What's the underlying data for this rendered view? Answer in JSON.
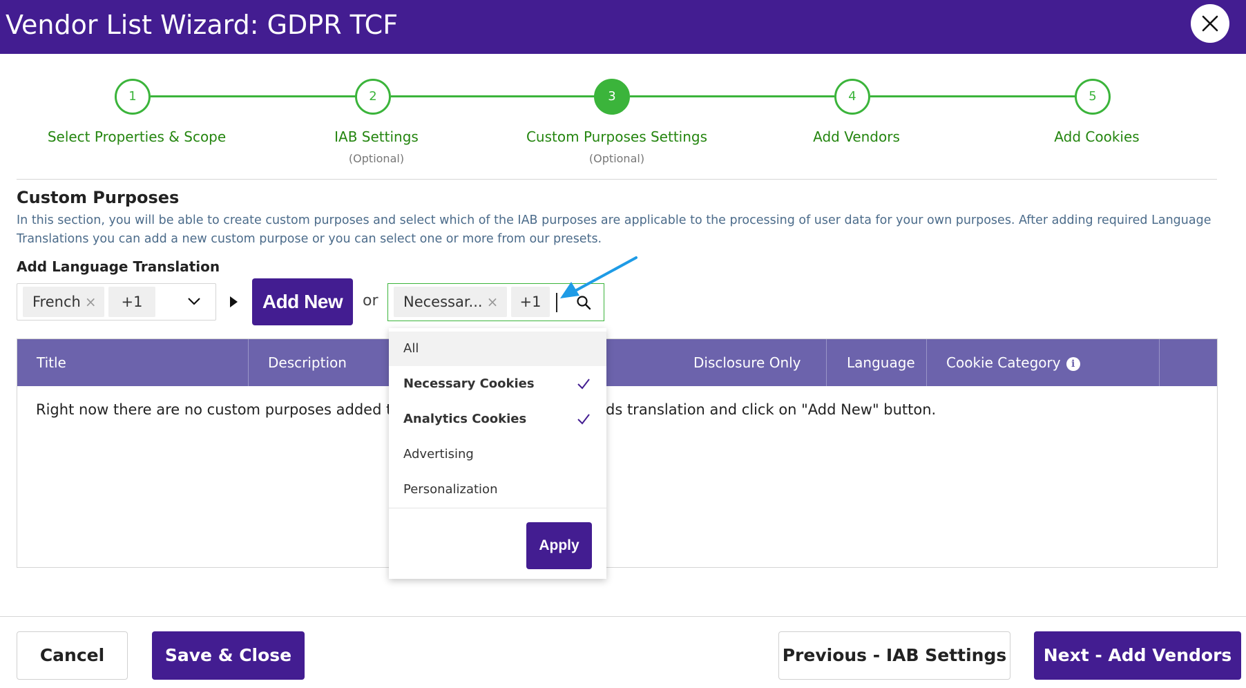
{
  "header": {
    "title": "Vendor List Wizard: GDPR TCF",
    "close_icon": "close-icon"
  },
  "stepper": {
    "steps": [
      {
        "number": "1",
        "label": "Select Properties & Scope",
        "sub": "",
        "state": "complete"
      },
      {
        "number": "2",
        "label": "IAB Settings",
        "sub": "(Optional)",
        "state": "complete"
      },
      {
        "number": "3",
        "label": "Custom Purposes Settings",
        "sub": "(Optional)",
        "state": "active"
      },
      {
        "number": "4",
        "label": "Add Vendors",
        "sub": "",
        "state": "upcoming"
      },
      {
        "number": "5",
        "label": "Add Cookies",
        "sub": "",
        "state": "upcoming"
      }
    ]
  },
  "section": {
    "title": "Custom Purposes",
    "description": "In this section, you will be able to create custom purposes and select which of the IAB purposes are applicable to the processing of user data for your own purposes. After adding required Language Translations you can add a new custom purpose or you can select one or more from our presets.",
    "add_language_label": "Add Language Translation"
  },
  "language_select": {
    "chip": "French",
    "chip_remove": "×",
    "more": "+1"
  },
  "add_new_label": "Add New",
  "or_label": "or",
  "purpose_select": {
    "chip": "Necessar...",
    "chip_remove": "×",
    "more": "+1"
  },
  "dropdown": {
    "items": [
      {
        "label": "All",
        "checked": false
      },
      {
        "label": "Necessary Cookies",
        "checked": true
      },
      {
        "label": "Analytics Cookies",
        "checked": true
      },
      {
        "label": "Advertising",
        "checked": false
      },
      {
        "label": "Personalization",
        "checked": false
      }
    ],
    "apply_label": "Apply"
  },
  "table": {
    "columns": [
      "Title",
      "Description",
      "Disclosure Only",
      "Language",
      "Cookie Category"
    ],
    "info_icon": "i",
    "empty_message_left": "Right now there are no custom purposes added to th",
    "empty_message_right": "ds translation and click on \"Add New\" button."
  },
  "footer": {
    "cancel": "Cancel",
    "save_close": "Save & Close",
    "previous": "Previous - IAB Settings",
    "next": "Next - Add Vendors"
  },
  "colors": {
    "brand": "#431d91",
    "step_green": "#3bb43b",
    "table_header": "#6c63ac",
    "annotation": "#1e9be6"
  }
}
